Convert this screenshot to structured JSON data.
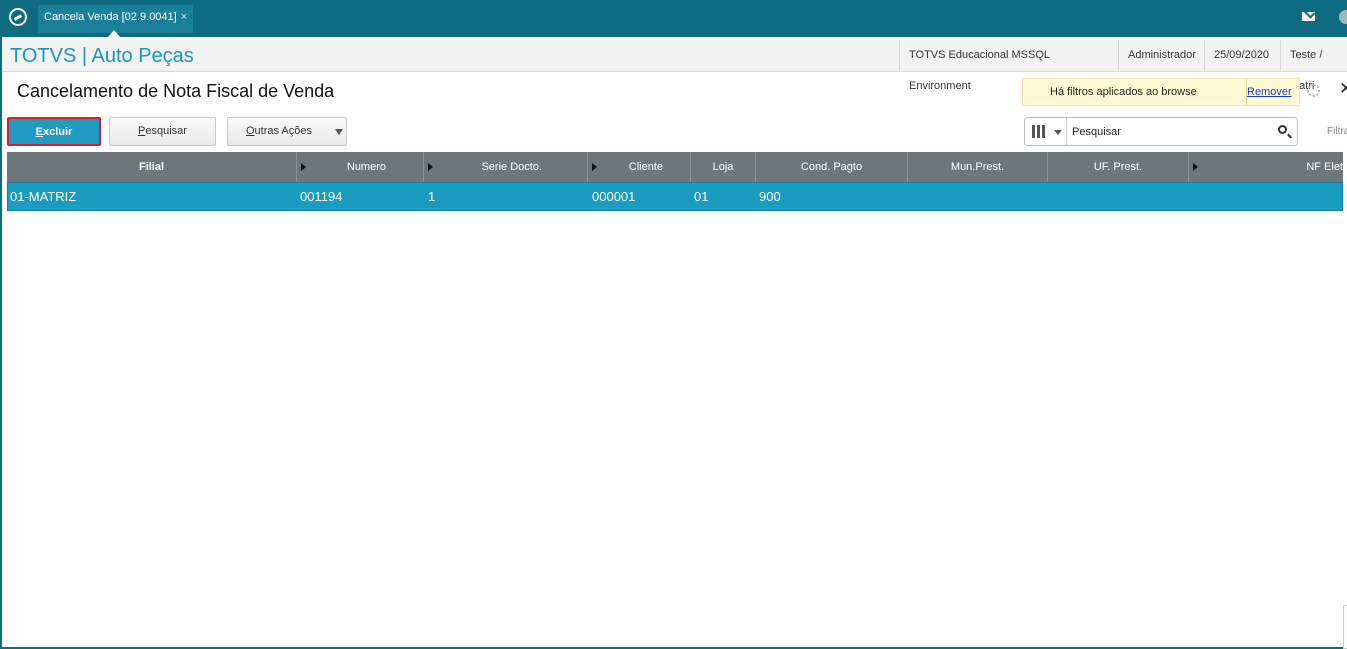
{
  "tab": {
    "label": "Cancela Venda [02.9.0041]",
    "close": "×"
  },
  "header": {
    "app_title": "TOTVS | Auto Peças",
    "environment": "TOTVS Educacional MSSQL Environment",
    "user": "Administrador",
    "date": "25/09/2020",
    "branch": "Teste / Matri"
  },
  "page": {
    "title": "Cancelamento de Nota Fiscal de Venda"
  },
  "filter_banner": {
    "text": "Há filtros aplicados ao browse",
    "remove": "Remover"
  },
  "close_glyph": "✕",
  "toolbar": {
    "excluir_prefix": "E",
    "excluir_rest": "xcluir",
    "pesquisar_prefix": "P",
    "pesquisar_rest": "esquisar",
    "outras_prefix": "O",
    "outras_rest": "utras Ações"
  },
  "search": {
    "value": "Pesquisar",
    "filter_label": "Filtrar"
  },
  "grid": {
    "columns": [
      "Filial",
      "Numero",
      "Serie Docto.",
      "Cliente",
      "Loja",
      "Cond. Pagto",
      "Mun.Prest.",
      "UF. Prest.",
      "NF Elet"
    ],
    "rows": [
      {
        "filial": "01-MATRIZ",
        "numero": "001194",
        "serie": "1",
        "cliente": "000001",
        "loja": "01",
        "cond_pagto": "900",
        "mun_prest": "",
        "uf_prest": "",
        "nf_elet": ""
      }
    ]
  },
  "colors": {
    "topbar": "#0f6b82",
    "accent": "#1a95c1",
    "selected_row": "#1a9bc0",
    "highlight_border": "#d7202a"
  }
}
